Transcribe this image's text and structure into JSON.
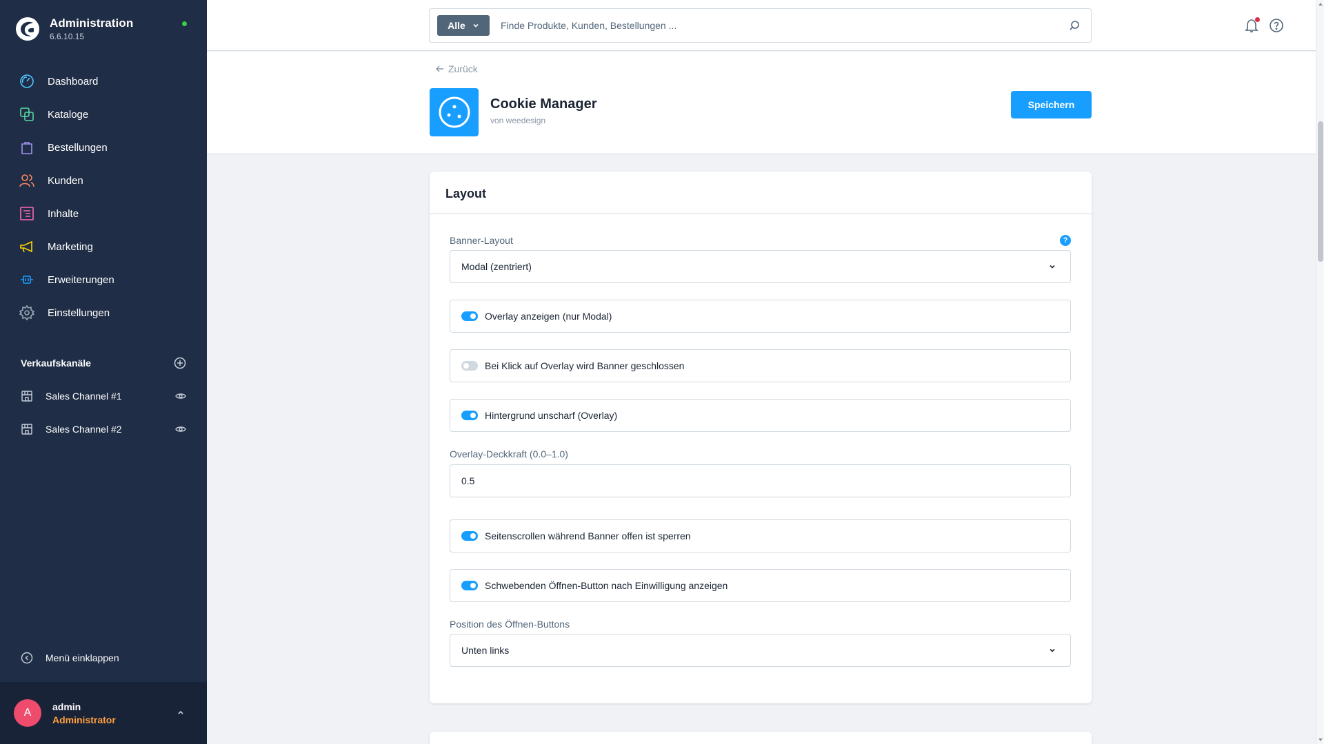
{
  "brand": {
    "title": "Administration",
    "version": "6.6.10.15"
  },
  "nav": [
    {
      "label": "Dashboard",
      "icon": "dashboard-icon",
      "color": "#52c7ff"
    },
    {
      "label": "Kataloge",
      "icon": "catalog-icon",
      "color": "#57d9a3"
    },
    {
      "label": "Bestellungen",
      "icon": "bag-icon",
      "color": "#a092f0"
    },
    {
      "label": "Kunden",
      "icon": "customers-icon",
      "color": "#f88962"
    },
    {
      "label": "Inhalte",
      "icon": "content-icon",
      "color": "#ff68b4"
    },
    {
      "label": "Marketing",
      "icon": "megaphone-icon",
      "color": "#ffd700"
    },
    {
      "label": "Erweiterungen",
      "icon": "plug-icon",
      "color": "#189eff"
    },
    {
      "label": "Einstellungen",
      "icon": "gear-icon",
      "color": "#9aa8b5"
    }
  ],
  "sales_channels": {
    "title": "Verkaufskanäle",
    "items": [
      {
        "label": "Sales Channel #1"
      },
      {
        "label": "Sales Channel #2"
      }
    ]
  },
  "collapse_label": "Menü einklappen",
  "user": {
    "initial": "A",
    "name": "admin",
    "role": "Administrator"
  },
  "search": {
    "type": "Alle",
    "placeholder": "Finde Produkte, Kunden, Bestellungen ..."
  },
  "header": {
    "back_label": "Zurück",
    "plugin_name": "Cookie Manager",
    "vendor": "von weedesign",
    "save_label": "Speichern"
  },
  "card": {
    "title": "Layout",
    "banner_layout_label": "Banner-Layout",
    "banner_layout_value": "Modal (zentriert)",
    "toggles": [
      {
        "label": "Overlay anzeigen (nur Modal)",
        "on": true
      },
      {
        "label": "Bei Klick auf Overlay wird Banner geschlossen",
        "on": false
      },
      {
        "label": "Hintergrund unscharf (Overlay)",
        "on": true
      }
    ],
    "opacity_label": "Overlay-Deckkraft (0.0–1.0)",
    "opacity_value": "0.5",
    "toggles2": [
      {
        "label": "Seitenscrollen während Banner offen ist sperren",
        "on": true
      },
      {
        "label": "Schwebenden Öffnen-Button nach Einwilligung anzeigen",
        "on": true
      }
    ],
    "position_label": "Position des Öffnen-Buttons",
    "position_value": "Unten links"
  },
  "colors": {
    "sidebar": "#1f2d46",
    "accent": "#189eff",
    "status": "#37d046",
    "role": "#ff9f3d",
    "avatar": "#ee4b6d"
  }
}
